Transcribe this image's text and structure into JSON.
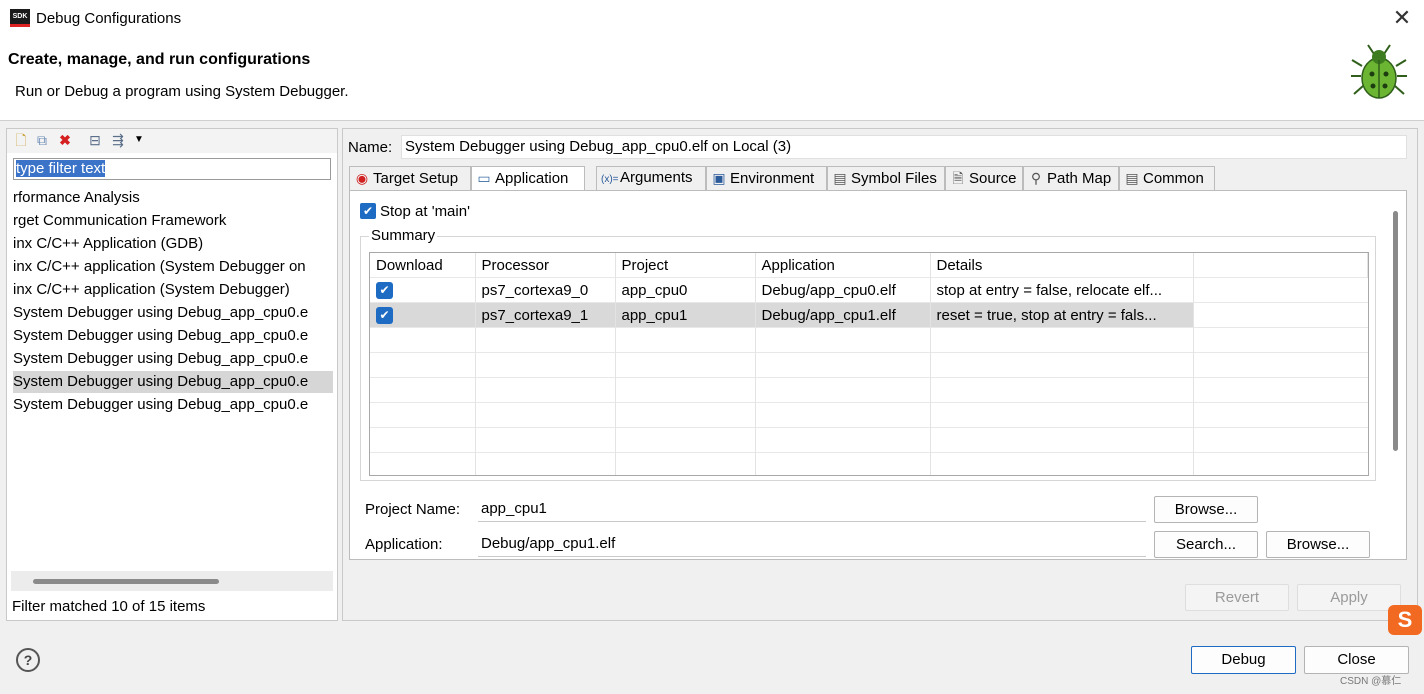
{
  "window": {
    "title": "Debug Configurations",
    "app_icon_text": "SDK"
  },
  "header": {
    "title": "Create, manage, and run configurations",
    "subtitle": "Run or Debug a program using System Debugger."
  },
  "left": {
    "filter_value": "type filter text",
    "items": [
      "rformance Analysis",
      "rget Communication Framework",
      "inx C/C++ Application (GDB)",
      "inx C/C++ application (System Debugger on",
      "inx C/C++ application (System Debugger)",
      "System Debugger using Debug_app_cpu0.e",
      "System Debugger using Debug_app_cpu0.e",
      "System Debugger using Debug_app_cpu0.e",
      "System Debugger using Debug_app_cpu0.e",
      "System Debugger using Debug_app_cpu0.e"
    ],
    "selected_index": 8,
    "status": "Filter matched 10 of 15 items"
  },
  "main": {
    "name_label": "Name:",
    "name_value": "System Debugger using Debug_app_cpu0.elf on Local (3)",
    "tabs": [
      "Target Setup",
      "Application",
      "Arguments",
      "Environment",
      "Symbol Files",
      "Source",
      "Path Map",
      "Common"
    ],
    "active_tab": "Application",
    "stop_at_main": "Stop at 'main'",
    "summary_label": "Summary",
    "table": {
      "headers": [
        "Download",
        "Processor",
        "Project",
        "Application",
        "Details"
      ],
      "rows": [
        {
          "processor": "ps7_cortexa9_0",
          "project": "app_cpu0",
          "application": "Debug/app_cpu0.elf",
          "details": "stop at entry = false, relocate elf..."
        },
        {
          "processor": "ps7_cortexa9_1",
          "project": "app_cpu1",
          "application": "Debug/app_cpu1.elf",
          "details": "reset = true, stop at entry = fals..."
        }
      ]
    },
    "project_name_label": "Project Name:",
    "project_name_value": "app_cpu1",
    "application_label": "Application:",
    "application_value": "Debug/app_cpu1.elf",
    "browse_label": "Browse...",
    "search_label": "Search...",
    "revert_label": "Revert",
    "apply_label": "Apply"
  },
  "footer": {
    "debug_label": "Debug",
    "close_label": "Close",
    "sogou_text": "S",
    "watermark": "CSDN @慕仁"
  },
  "colors": {
    "accent": "#1e6bc4",
    "selection": "#d9d9d9"
  }
}
